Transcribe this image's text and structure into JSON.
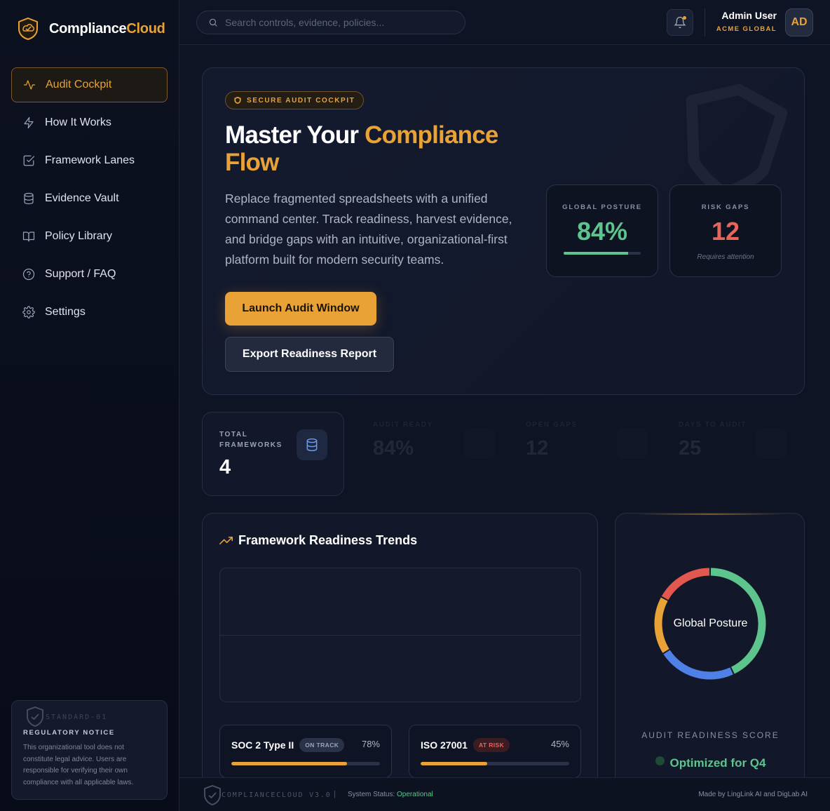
{
  "brand": {
    "name_main": "Compliance",
    "name_accent": "Cloud"
  },
  "sidebar": {
    "items": [
      {
        "label": "Audit Cockpit",
        "icon": "activity-icon",
        "active": true
      },
      {
        "label": "How It Works",
        "icon": "zap-icon"
      },
      {
        "label": "Framework Lanes",
        "icon": "check-square-icon"
      },
      {
        "label": "Evidence Vault",
        "icon": "database-icon"
      },
      {
        "label": "Policy Library",
        "icon": "book-icon"
      },
      {
        "label": "Support / FAQ",
        "icon": "help-circle-icon"
      },
      {
        "label": "Settings",
        "icon": "gear-icon"
      }
    ],
    "notice": {
      "code": "STANDARD-01",
      "title": "REGULATORY NOTICE",
      "text": "This organizational tool does not constitute legal advice. Users are responsible for verifying their own compliance with all applicable laws."
    }
  },
  "topbar": {
    "search_placeholder": "Search controls, evidence, policies...",
    "user_name": "Admin User",
    "user_org": "ACME GLOBAL",
    "avatar_initials": "AD"
  },
  "hero": {
    "badge": "SECURE AUDIT COCKPIT",
    "title_plain": "Master Your ",
    "title_accent": "Compliance Flow",
    "description": "Replace fragmented spreadsheets with a unified command center. Track readiness, harvest evidence, and bridge gaps with an intuitive, organizational-first platform built for modern security teams.",
    "launch_label": "Launch Audit Window",
    "export_label": "Export Readiness Report",
    "posture": {
      "label": "GLOBAL POSTURE",
      "value": "84%",
      "progress": 0.84
    },
    "risk": {
      "label": "RISK GAPS",
      "value": "12",
      "sub": "Requires attention"
    }
  },
  "kpis": {
    "total": {
      "label": "TOTAL FRAMEWORKS",
      "value": "4"
    },
    "ghosts": [
      {
        "label": "AUDIT READY",
        "value": "84%"
      },
      {
        "label": "OPEN GAPS",
        "value": "12"
      },
      {
        "label": "DAYS TO AUDIT",
        "value": "25"
      }
    ]
  },
  "trends": {
    "title": "Framework Readiness Trends",
    "frameworks": [
      {
        "name": "SOC 2 Type II",
        "status": "ON TRACK",
        "percent_label": "78%",
        "progress": 0.78
      },
      {
        "name": "ISO 27001",
        "status": "AT RISK",
        "percent_label": "45%",
        "progress": 0.45
      }
    ]
  },
  "donut": {
    "center_label": "Global Posture",
    "score_label": "AUDIT READINESS SCORE",
    "status": "Optimized for Q4",
    "segments": [
      {
        "color": "#5cc48c",
        "share": 0.43
      },
      {
        "color": "#4f80e6",
        "share": 0.23
      },
      {
        "color": "#e8a236",
        "share": 0.17
      },
      {
        "color": "#e2584f",
        "share": 0.17
      }
    ]
  },
  "footer": {
    "version": "COMPLIANCECLOUD V3.0",
    "separator": "|",
    "status_label": "System Status: ",
    "status_value": "Operational",
    "credit": "Made by LingLink AI and DigLab AI"
  },
  "colors": {
    "accent": "#e8a236",
    "success": "#5cc48c",
    "danger": "#e8655a",
    "info": "#6d9ae8"
  }
}
